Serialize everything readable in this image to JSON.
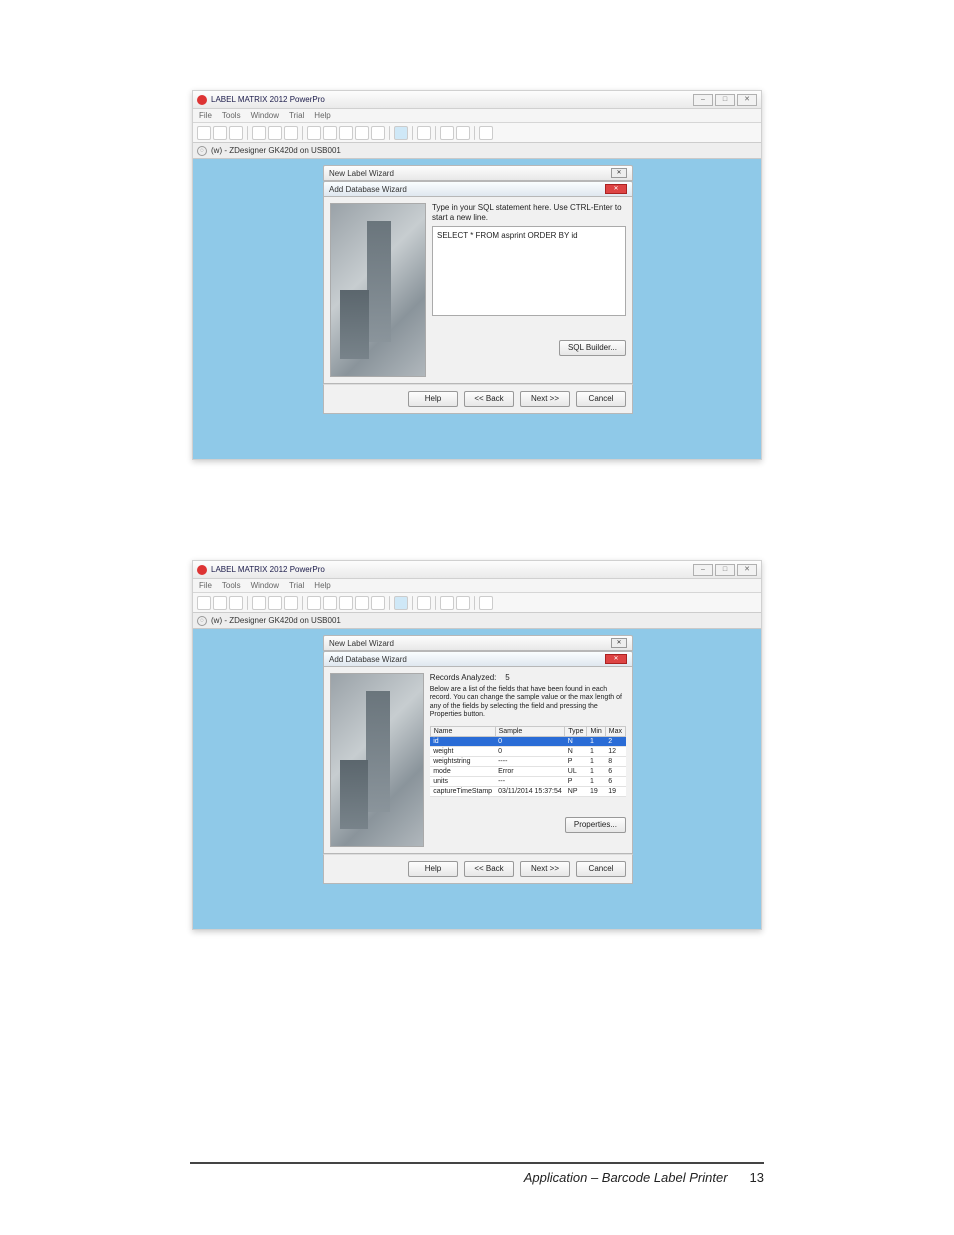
{
  "footer": {
    "section": "Application – Barcode Label Printer",
    "page": "13"
  },
  "app": {
    "title": "LABEL MATRIX 2012 PowerPro",
    "menus": [
      "File",
      "Tools",
      "Window",
      "Trial",
      "Help"
    ],
    "doc_tab": "(w) - ZDesigner GK420d on USB001",
    "win_buttons": {
      "min": "–",
      "max": "□",
      "close": "✕"
    }
  },
  "shot1": {
    "new_label_wizard_title": "New Label Wizard",
    "add_db_wizard_title": "Add Database Wizard",
    "instruction": "Type in your SQL statement here.  Use CTRL-Enter to start a new line.",
    "sql_text": "SELECT * FROM asprint  ORDER BY id",
    "sql_builder_btn": "SQL Builder...",
    "buttons": {
      "help": "Help",
      "back": "<< Back",
      "next": "Next >>",
      "cancel": "Cancel"
    }
  },
  "shot2": {
    "new_label_wizard_title": "New Label Wizard",
    "add_db_wizard_title": "Add Database Wizard",
    "records_label": "Records Analyzed:",
    "records_value": "5",
    "description": "Below are a list of the fields that have been found in each record.  You can change the sample value or the max length of any of the fields by selecting the field and pressing the Properties button.",
    "columns": [
      "Name",
      "Sample",
      "Type",
      "Min",
      "Max"
    ],
    "rows": [
      {
        "name": "id",
        "sample": "0",
        "type": "N",
        "min": "1",
        "max": "2",
        "sel": true
      },
      {
        "name": "weight",
        "sample": "0",
        "type": "N",
        "min": "1",
        "max": "12"
      },
      {
        "name": "weightstring",
        "sample": "----",
        "type": "P",
        "min": "1",
        "max": "8"
      },
      {
        "name": "mode",
        "sample": "Error",
        "type": "UL",
        "min": "1",
        "max": "6"
      },
      {
        "name": "units",
        "sample": "---",
        "type": "P",
        "min": "1",
        "max": "6"
      },
      {
        "name": "captureTimeStamp",
        "sample": "03/11/2014 15:37:54",
        "type": "NP",
        "min": "19",
        "max": "19"
      }
    ],
    "properties_btn": "Properties...",
    "buttons": {
      "help": "Help",
      "back": "<< Back",
      "next": "Next >>",
      "cancel": "Cancel"
    }
  }
}
